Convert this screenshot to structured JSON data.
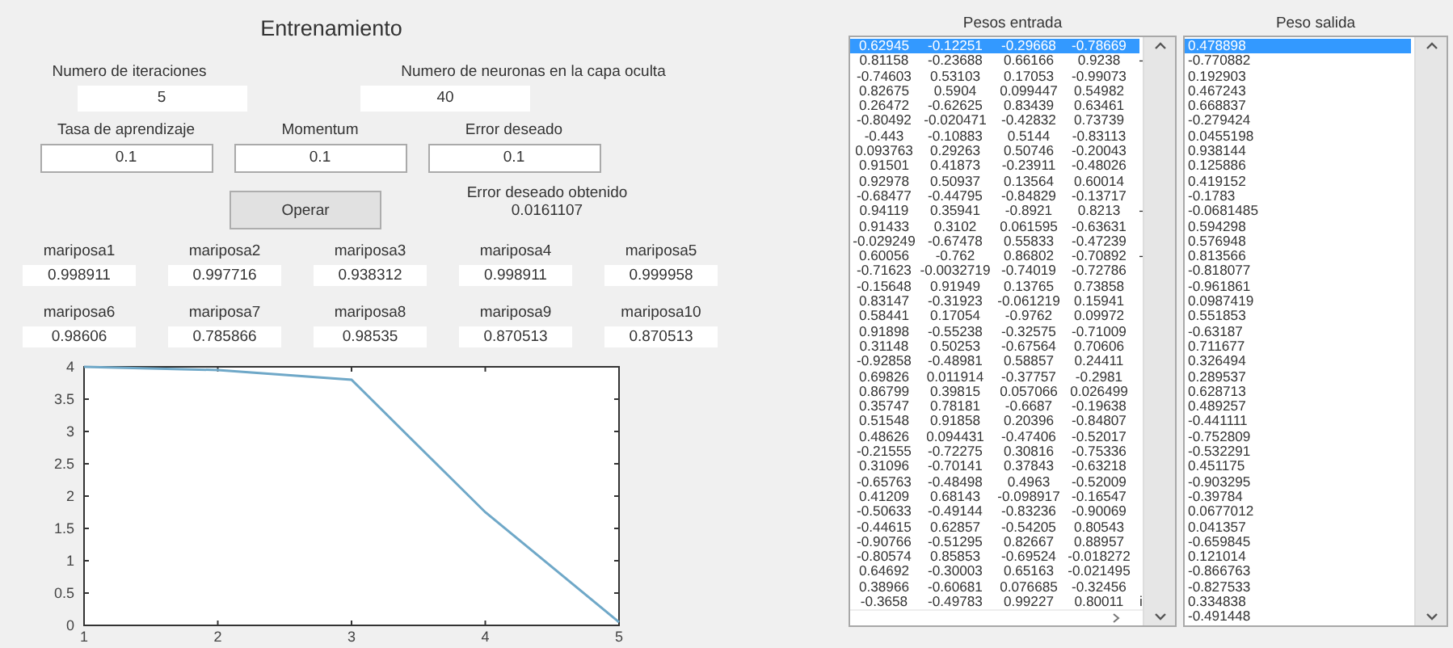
{
  "title": "Entrenamiento",
  "parameters_top": [
    {
      "label": "Numero de iteraciones",
      "value": "5"
    },
    {
      "label": "Numero de neuronas en la capa oculta",
      "value": "40"
    }
  ],
  "parameters": [
    {
      "label": "Tasa de aprendizaje",
      "value": "0.1"
    },
    {
      "label": "Momentum",
      "value": "0.1"
    },
    {
      "label": "Error deseado",
      "value": "0.1"
    }
  ],
  "operate_button": "Operar",
  "error_obtained": {
    "label": "Error deseado obtenido",
    "value": "0.0161107"
  },
  "outputs": [
    {
      "label": "mariposa1",
      "value": "0.998911"
    },
    {
      "label": "mariposa2",
      "value": "0.997716"
    },
    {
      "label": "mariposa3",
      "value": "0.938312"
    },
    {
      "label": "mariposa4",
      "value": "0.998911"
    },
    {
      "label": "mariposa5",
      "value": "0.999958"
    },
    {
      "label": "mariposa6",
      "value": "0.98606"
    },
    {
      "label": "mariposa7",
      "value": "0.785866"
    },
    {
      "label": "mariposa8",
      "value": "0.98535"
    },
    {
      "label": "mariposa9",
      "value": "0.870513"
    },
    {
      "label": "mariposa10",
      "value": "0.870513"
    }
  ],
  "error_chart": {
    "chart_data": {
      "type": "line",
      "x": [
        1,
        2,
        3,
        4,
        5
      ],
      "series": [
        {
          "color": "#6fa8c8",
          "values": [
            4,
            3.95,
            3.8,
            1.75,
            0.05
          ]
        }
      ],
      "xlim": [
        1,
        5
      ],
      "ylim": [
        0,
        4
      ],
      "xticks": [
        1,
        2,
        3,
        4,
        5
      ],
      "yticks": [
        0,
        0.5,
        1,
        1.5,
        2,
        2.5,
        3,
        3.5,
        4
      ]
    }
  },
  "weights_in": {
    "title": "Pesos entrada",
    "rows": [
      {
        "cells": [
          "0.62945",
          "-0.12251",
          "-0.29668",
          "-0.78669"
        ],
        "selected": true
      },
      {
        "cells": [
          "0.81158",
          "-0.23688",
          "0.66166",
          "0.9238",
          "-"
        ],
        "selected": false
      },
      {
        "cells": [
          "-0.74603",
          "0.53103",
          "0.17053",
          "-0.99073"
        ],
        "selected": false
      },
      {
        "cells": [
          "0.82675",
          "0.5904",
          "0.099447",
          "0.54982"
        ],
        "selected": false
      },
      {
        "cells": [
          "0.26472",
          "-0.62625",
          "0.83439",
          "0.63461"
        ],
        "selected": false
      },
      {
        "cells": [
          "-0.80492",
          "-0.020471",
          "-0.42832",
          "0.73739"
        ],
        "selected": false
      },
      {
        "cells": [
          "-0.443",
          "-0.10883",
          "0.5144",
          "-0.83113"
        ],
        "selected": false
      },
      {
        "cells": [
          "0.093763",
          "0.29263",
          "0.50746",
          "-0.20043"
        ],
        "selected": false
      },
      {
        "cells": [
          "0.91501",
          "0.41873",
          "-0.23911",
          "-0.48026"
        ],
        "selected": false
      },
      {
        "cells": [
          "0.92978",
          "0.50937",
          "0.13564",
          "0.60014"
        ],
        "selected": false
      },
      {
        "cells": [
          "-0.68477",
          "-0.44795",
          "-0.84829",
          "-0.13717"
        ],
        "selected": false
      },
      {
        "cells": [
          "0.94119",
          "0.35941",
          "-0.8921",
          "0.8213",
          "-"
        ],
        "selected": false
      },
      {
        "cells": [
          "0.91433",
          "0.3102",
          "0.061595",
          "-0.63631"
        ],
        "selected": false
      },
      {
        "cells": [
          "-0.029249",
          "-0.67478",
          "0.55833",
          "-0.47239"
        ],
        "selected": false
      },
      {
        "cells": [
          "0.60056",
          "-0.762",
          "0.86802",
          "-0.70892",
          "-"
        ],
        "selected": false
      },
      {
        "cells": [
          "-0.71623",
          "-0.0032719",
          "-0.74019",
          "-0.72786"
        ],
        "selected": false
      },
      {
        "cells": [
          "-0.15648",
          "0.91949",
          "0.13765",
          "0.73858"
        ],
        "selected": false
      },
      {
        "cells": [
          "0.83147",
          "-0.31923",
          "-0.061219",
          "0.15941"
        ],
        "selected": false
      },
      {
        "cells": [
          "0.58441",
          "0.17054",
          "-0.9762",
          "0.09972"
        ],
        "selected": false
      },
      {
        "cells": [
          "0.91898",
          "-0.55238",
          "-0.32575",
          "-0.71009"
        ],
        "selected": false
      },
      {
        "cells": [
          "0.31148",
          "0.50253",
          "-0.67564",
          "0.70606"
        ],
        "selected": false
      },
      {
        "cells": [
          "-0.92858",
          "-0.48981",
          "0.58857",
          "0.24411"
        ],
        "selected": false
      },
      {
        "cells": [
          "0.69826",
          "0.011914",
          "-0.37757",
          "-0.2981"
        ],
        "selected": false
      },
      {
        "cells": [
          "0.86799",
          "0.39815",
          "0.057066",
          "0.026499"
        ],
        "selected": false
      },
      {
        "cells": [
          "0.35747",
          "0.78181",
          "-0.6687",
          "-0.19638"
        ],
        "selected": false
      },
      {
        "cells": [
          "0.51548",
          "0.91858",
          "0.20396",
          "-0.84807"
        ],
        "selected": false
      },
      {
        "cells": [
          "0.48626",
          "0.094431",
          "-0.47406",
          "-0.52017"
        ],
        "selected": false
      },
      {
        "cells": [
          "-0.21555",
          "-0.72275",
          "0.30816",
          "-0.75336"
        ],
        "selected": false
      },
      {
        "cells": [
          "0.31096",
          "-0.70141",
          "0.37843",
          "-0.63218"
        ],
        "selected": false
      },
      {
        "cells": [
          "-0.65763",
          "-0.48498",
          "0.4963",
          "-0.52009"
        ],
        "selected": false
      },
      {
        "cells": [
          "0.41209",
          "0.68143",
          "-0.098917",
          "-0.16547"
        ],
        "selected": false
      },
      {
        "cells": [
          "-0.50633",
          "-0.49144",
          "-0.83236",
          "-0.90069"
        ],
        "selected": false
      },
      {
        "cells": [
          "-0.44615",
          "0.62857",
          "-0.54205",
          "0.80543"
        ],
        "selected": false
      },
      {
        "cells": [
          "-0.90766",
          "-0.51295",
          "0.82667",
          "0.88957"
        ],
        "selected": false
      },
      {
        "cells": [
          "-0.80574",
          "0.85853",
          "-0.69524",
          "-0.018272"
        ],
        "selected": false
      },
      {
        "cells": [
          "0.64692",
          "-0.30003",
          "0.65163",
          "-0.021495"
        ],
        "selected": false
      },
      {
        "cells": [
          "0.38966",
          "-0.60681",
          "0.076685",
          "-0.32456"
        ],
        "selected": false
      },
      {
        "cells": [
          "-0.3658",
          "-0.49783",
          "0.99227",
          "0.80011",
          "i"
        ],
        "selected": false
      }
    ]
  },
  "weights_out": {
    "title": "Peso salida",
    "rows": [
      {
        "value": "0.478898",
        "selected": true
      },
      {
        "value": "-0.770882",
        "selected": false
      },
      {
        "value": "0.192903",
        "selected": false
      },
      {
        "value": "0.467243",
        "selected": false
      },
      {
        "value": "0.668837",
        "selected": false
      },
      {
        "value": "-0.279424",
        "selected": false
      },
      {
        "value": "0.0455198",
        "selected": false
      },
      {
        "value": "0.938144",
        "selected": false
      },
      {
        "value": "0.125886",
        "selected": false
      },
      {
        "value": "0.419152",
        "selected": false
      },
      {
        "value": "-0.1783",
        "selected": false
      },
      {
        "value": "-0.0681485",
        "selected": false
      },
      {
        "value": "0.594298",
        "selected": false
      },
      {
        "value": "0.576948",
        "selected": false
      },
      {
        "value": "0.813566",
        "selected": false
      },
      {
        "value": "-0.818077",
        "selected": false
      },
      {
        "value": "-0.961861",
        "selected": false
      },
      {
        "value": "0.0987419",
        "selected": false
      },
      {
        "value": "0.551853",
        "selected": false
      },
      {
        "value": "-0.63187",
        "selected": false
      },
      {
        "value": "0.711677",
        "selected": false
      },
      {
        "value": "0.326494",
        "selected": false
      },
      {
        "value": "0.289537",
        "selected": false
      },
      {
        "value": "0.628713",
        "selected": false
      },
      {
        "value": "0.489257",
        "selected": false
      },
      {
        "value": "-0.441111",
        "selected": false
      },
      {
        "value": "-0.752809",
        "selected": false
      },
      {
        "value": "-0.532291",
        "selected": false
      },
      {
        "value": "0.451175",
        "selected": false
      },
      {
        "value": "-0.903295",
        "selected": false
      },
      {
        "value": "-0.39784",
        "selected": false
      },
      {
        "value": "0.0677012",
        "selected": false
      },
      {
        "value": "0.041357",
        "selected": false
      },
      {
        "value": "-0.659845",
        "selected": false
      },
      {
        "value": "0.121014",
        "selected": false
      },
      {
        "value": "-0.866763",
        "selected": false
      },
      {
        "value": "-0.827533",
        "selected": false
      },
      {
        "value": "0.334838",
        "selected": false
      },
      {
        "value": "-0.491448",
        "selected": false
      }
    ]
  }
}
